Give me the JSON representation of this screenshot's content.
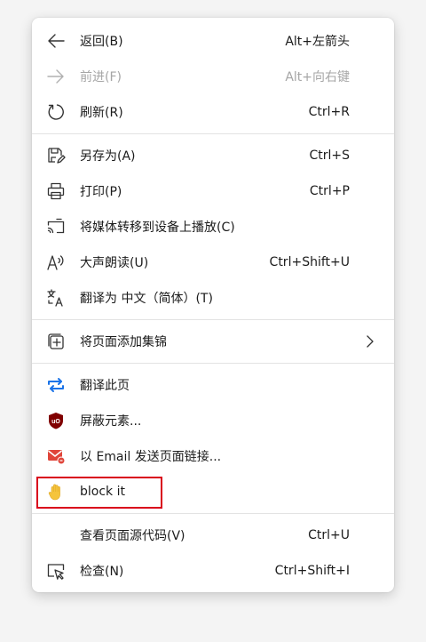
{
  "menu": {
    "back": {
      "label": "返回(B)",
      "shortcut": "Alt+左箭头"
    },
    "forward": {
      "label": "前进(F)",
      "shortcut": "Alt+向右键"
    },
    "refresh": {
      "label": "刷新(R)",
      "shortcut": "Ctrl+R"
    },
    "save_as": {
      "label": "另存为(A)",
      "shortcut": "Ctrl+S"
    },
    "print": {
      "label": "打印(P)",
      "shortcut": "Ctrl+P"
    },
    "cast": {
      "label": "将媒体转移到设备上播放(C)"
    },
    "read_aloud": {
      "label": "大声朗读(U)",
      "shortcut": "Ctrl+Shift+U"
    },
    "translate_to": {
      "label": "翻译为 中文（简体）(T)"
    },
    "add_collection": {
      "label": "将页面添加集锦"
    },
    "translate_page": {
      "label": "翻译此页"
    },
    "block_element": {
      "label": "屏蔽元素..."
    },
    "email": {
      "label": "以 Email 发送页面链接..."
    },
    "block_it": {
      "label": "block it"
    },
    "view_source": {
      "label": "查看页面源代码(V)",
      "shortcut": "Ctrl+U"
    },
    "inspect": {
      "label": "检查(N)",
      "shortcut": "Ctrl+Shift+I"
    }
  },
  "colors": {
    "highlight_border": "#d9001b",
    "translate_icon": "#1a73e8",
    "ublock_red": "#800000",
    "email_red": "#e0453a",
    "hand_yellow": "#f5c43c",
    "disabled_text": "#a6a6a6"
  },
  "icons": {
    "back": "arrow-left-icon",
    "forward": "arrow-right-icon",
    "refresh": "refresh-icon",
    "save_as": "save-as-icon",
    "print": "printer-icon",
    "cast": "cast-icon",
    "read_aloud": "read-aloud-icon",
    "translate_to": "translate-icon",
    "add_collection": "collection-add-icon",
    "translate_page": "translate-arrows-icon",
    "block_element": "ublock-shield-icon",
    "email": "email-icon",
    "block_it": "hand-icon",
    "inspect": "inspect-icon"
  }
}
